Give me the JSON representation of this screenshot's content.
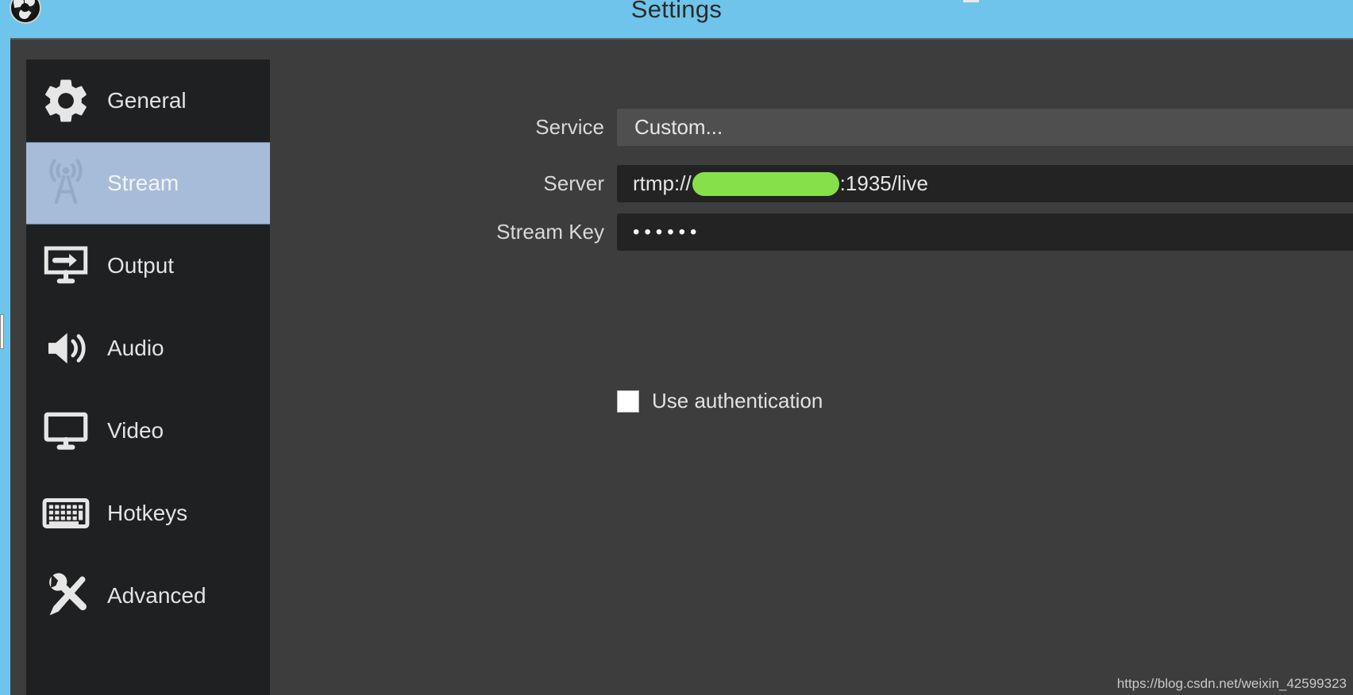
{
  "window": {
    "title": "Settings",
    "logo_icon": "obs-logo-icon",
    "minimize_icon": "minimize-icon",
    "titlebar_color": "#6ec4ea",
    "dialog_bg": "#3d3d3d"
  },
  "sidebar": {
    "selected_index": 1,
    "selected_color": "#a7bcd8",
    "bg": "#1f2021",
    "items": [
      {
        "id": "general",
        "label": "General",
        "icon": "gear-icon"
      },
      {
        "id": "stream",
        "label": "Stream",
        "icon": "broadcast-tower-icon"
      },
      {
        "id": "output",
        "label": "Output",
        "icon": "monitor-arrow-icon"
      },
      {
        "id": "audio",
        "label": "Audio",
        "icon": "speaker-icon"
      },
      {
        "id": "video",
        "label": "Video",
        "icon": "monitor-icon"
      },
      {
        "id": "hotkeys",
        "label": "Hotkeys",
        "icon": "keyboard-icon"
      },
      {
        "id": "advanced",
        "label": "Advanced",
        "icon": "wrench-screwdriver-icon"
      }
    ]
  },
  "stream_settings": {
    "service": {
      "label": "Service",
      "value": "Custom...",
      "type": "combobox"
    },
    "server": {
      "label": "Server",
      "prefix": "rtmp://",
      "redacted": true,
      "redaction_color": "#85e04a",
      "suffix": ":1935/live",
      "type": "text"
    },
    "stream_key": {
      "label": "Stream Key",
      "value": "••••••",
      "masked": true,
      "type": "password"
    },
    "use_authentication": {
      "label": "Use authentication",
      "checked": false
    }
  },
  "watermark": {
    "text": "https://blog.csdn.net/weixin_42599323"
  }
}
